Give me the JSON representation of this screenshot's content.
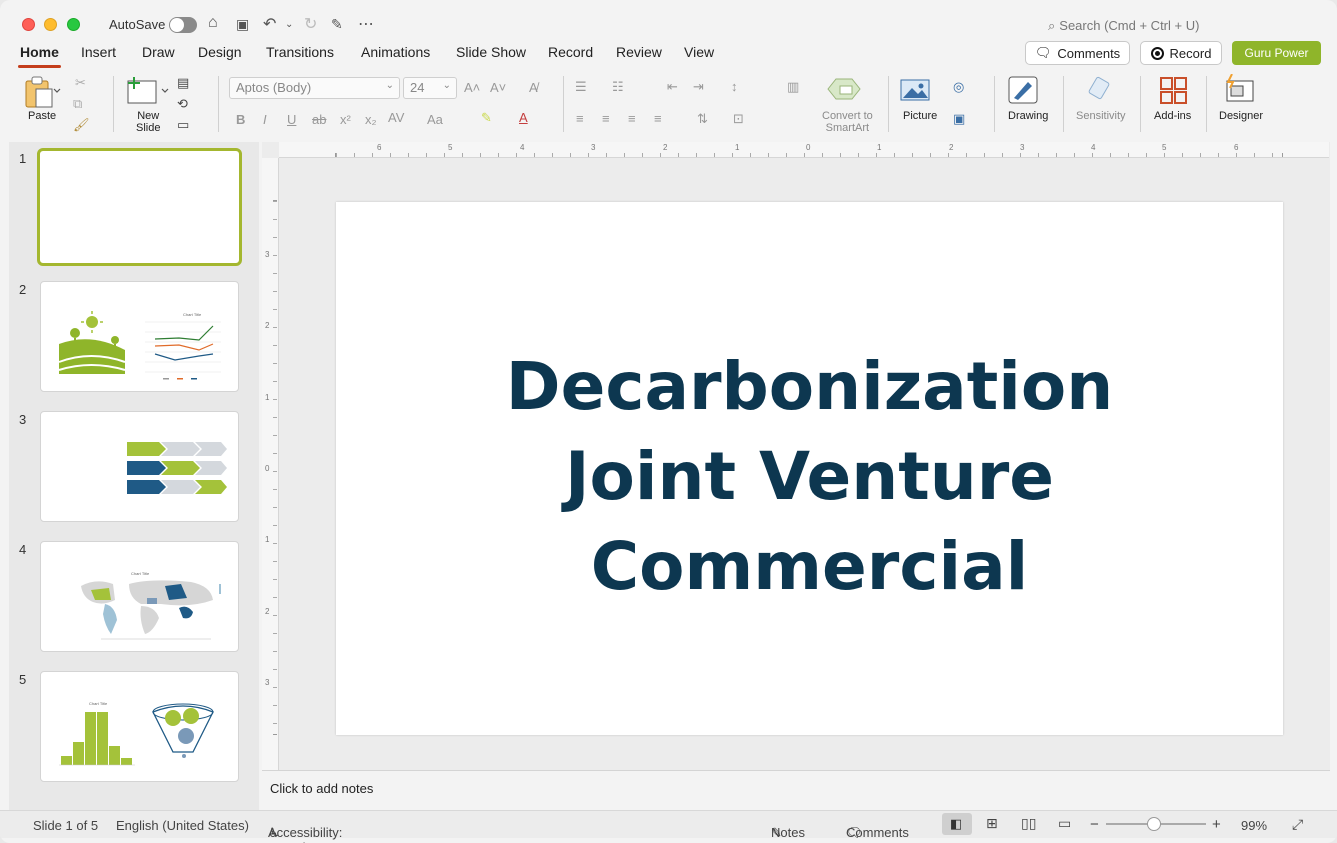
{
  "titlebar": {
    "autosave_label": "AutoSave",
    "search_placeholder": "Search (Cmd + Ctrl + U)"
  },
  "tabs": [
    "Home",
    "Insert",
    "Draw",
    "Design",
    "Transitions",
    "Animations",
    "Slide Show",
    "Record",
    "Review",
    "View"
  ],
  "actions": {
    "comments_label": "Comments",
    "record_label": "Record",
    "guru_label": "Guru Power",
    "guru_color": "#8fb52a"
  },
  "ribbon": {
    "paste_label": "Paste",
    "new_slide_label": "New Slide",
    "new_slide_line1": "New",
    "new_slide_line2": "Slide",
    "font_name": "Aptos (Body)",
    "font_size": "24",
    "convert_line1": "Convert to",
    "convert_line2": "SmartArt",
    "picture_label": "Picture",
    "drawing_label": "Drawing",
    "sensitivity_label": "Sensitivity",
    "addins_label": "Add-ins",
    "designer_label": "Designer"
  },
  "ruler": {
    "h_labels": [
      "6",
      "5",
      "4",
      "3",
      "2",
      "1",
      "0",
      "1",
      "2",
      "3",
      "4",
      "5",
      "6"
    ],
    "v_labels": [
      "3",
      "2",
      "1",
      "0",
      "1",
      "2",
      "3"
    ]
  },
  "thumbnails": [
    {
      "number": "1",
      "selected": true
    },
    {
      "number": "2",
      "chart_title": "Chart Title"
    },
    {
      "number": "3"
    },
    {
      "number": "4",
      "chart_title": "Chart Title"
    },
    {
      "number": "5",
      "chart_title": "Chart Title"
    }
  ],
  "slide": {
    "title_lines": [
      "Decarbonization",
      "Joint Venture",
      "Commercial"
    ],
    "title_color": "#0d3750"
  },
  "notes_placeholder": "Click to add notes",
  "status": {
    "slide_info": "Slide 1 of 5",
    "language": "English (United States)",
    "accessibility": "Accessibility: Investigate",
    "notes_label": "Notes",
    "comments_label": "Comments",
    "zoom": "99%"
  }
}
